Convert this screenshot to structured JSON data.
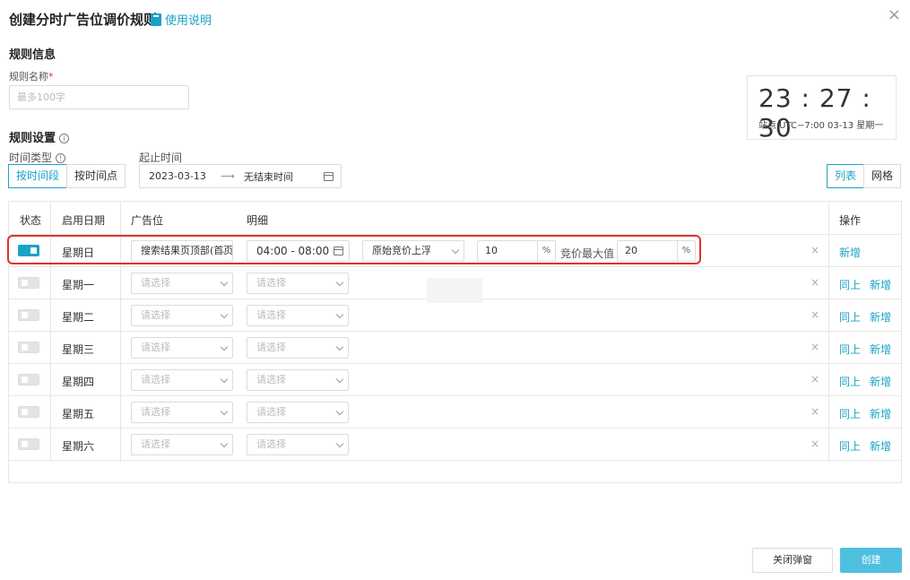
{
  "header": {
    "title": "创建分时广告位调价规则",
    "help_label": "使用说明"
  },
  "basic": {
    "section_title": "规则信息",
    "name_label": "规则名称",
    "required_mark": "*",
    "name_placeholder": "最多100字"
  },
  "clock": {
    "time": "23 : 27 : 30",
    "subtitle": "站点 UTC−7:00  03-13 星期一"
  },
  "settings": {
    "section_title": "规则设置",
    "time_type_label": "时间类型",
    "time_type_options": [
      "按时间段",
      "按时间点"
    ],
    "range_label": "起止时间",
    "start_date": "2023-03-13",
    "end_date": "无结束时间",
    "view_options": [
      "列表",
      "网格"
    ]
  },
  "table": {
    "headers": {
      "status": "状态",
      "day": "启用日期",
      "ad_slot": "广告位",
      "detail": "明细",
      "ops": "操作"
    },
    "rows": [
      {
        "day": "星期日",
        "on": true,
        "ad_slot": "搜索结果页顶部(首页)",
        "time_range": "04:00 - 08:00",
        "rule": "原始竞价上浮",
        "value": "10",
        "pct": "%",
        "max_label": "竞价最大值",
        "max_value": "20",
        "ops": [
          "新增"
        ]
      },
      {
        "day": "星期一",
        "on": false,
        "ad_slot": "请选择",
        "detail": "请选择",
        "ops": [
          "同上",
          "新增"
        ]
      },
      {
        "day": "星期二",
        "on": false,
        "ad_slot": "请选择",
        "detail": "请选择",
        "ops": [
          "同上",
          "新增"
        ]
      },
      {
        "day": "星期三",
        "on": false,
        "ad_slot": "请选择",
        "detail": "请选择",
        "ops": [
          "同上",
          "新增"
        ]
      },
      {
        "day": "星期四",
        "on": false,
        "ad_slot": "请选择",
        "detail": "请选择",
        "ops": [
          "同上",
          "新增"
        ]
      },
      {
        "day": "星期五",
        "on": false,
        "ad_slot": "请选择",
        "detail": "请选择",
        "ops": [
          "同上",
          "新增"
        ]
      },
      {
        "day": "星期六",
        "on": false,
        "ad_slot": "请选择",
        "detail": "请选择",
        "ops": [
          "同上",
          "新增"
        ]
      }
    ],
    "delete_glyph": "×"
  },
  "footer": {
    "close_label": "关闭弹窗",
    "create_label": "创建"
  },
  "colors": {
    "accent": "#1aa3c8",
    "highlight": "#e03030"
  },
  "icons": {
    "help": "book-icon",
    "close": "close-icon",
    "info": "info-icon",
    "calendar": "calendar-icon",
    "select": "chevron-down-icon"
  }
}
